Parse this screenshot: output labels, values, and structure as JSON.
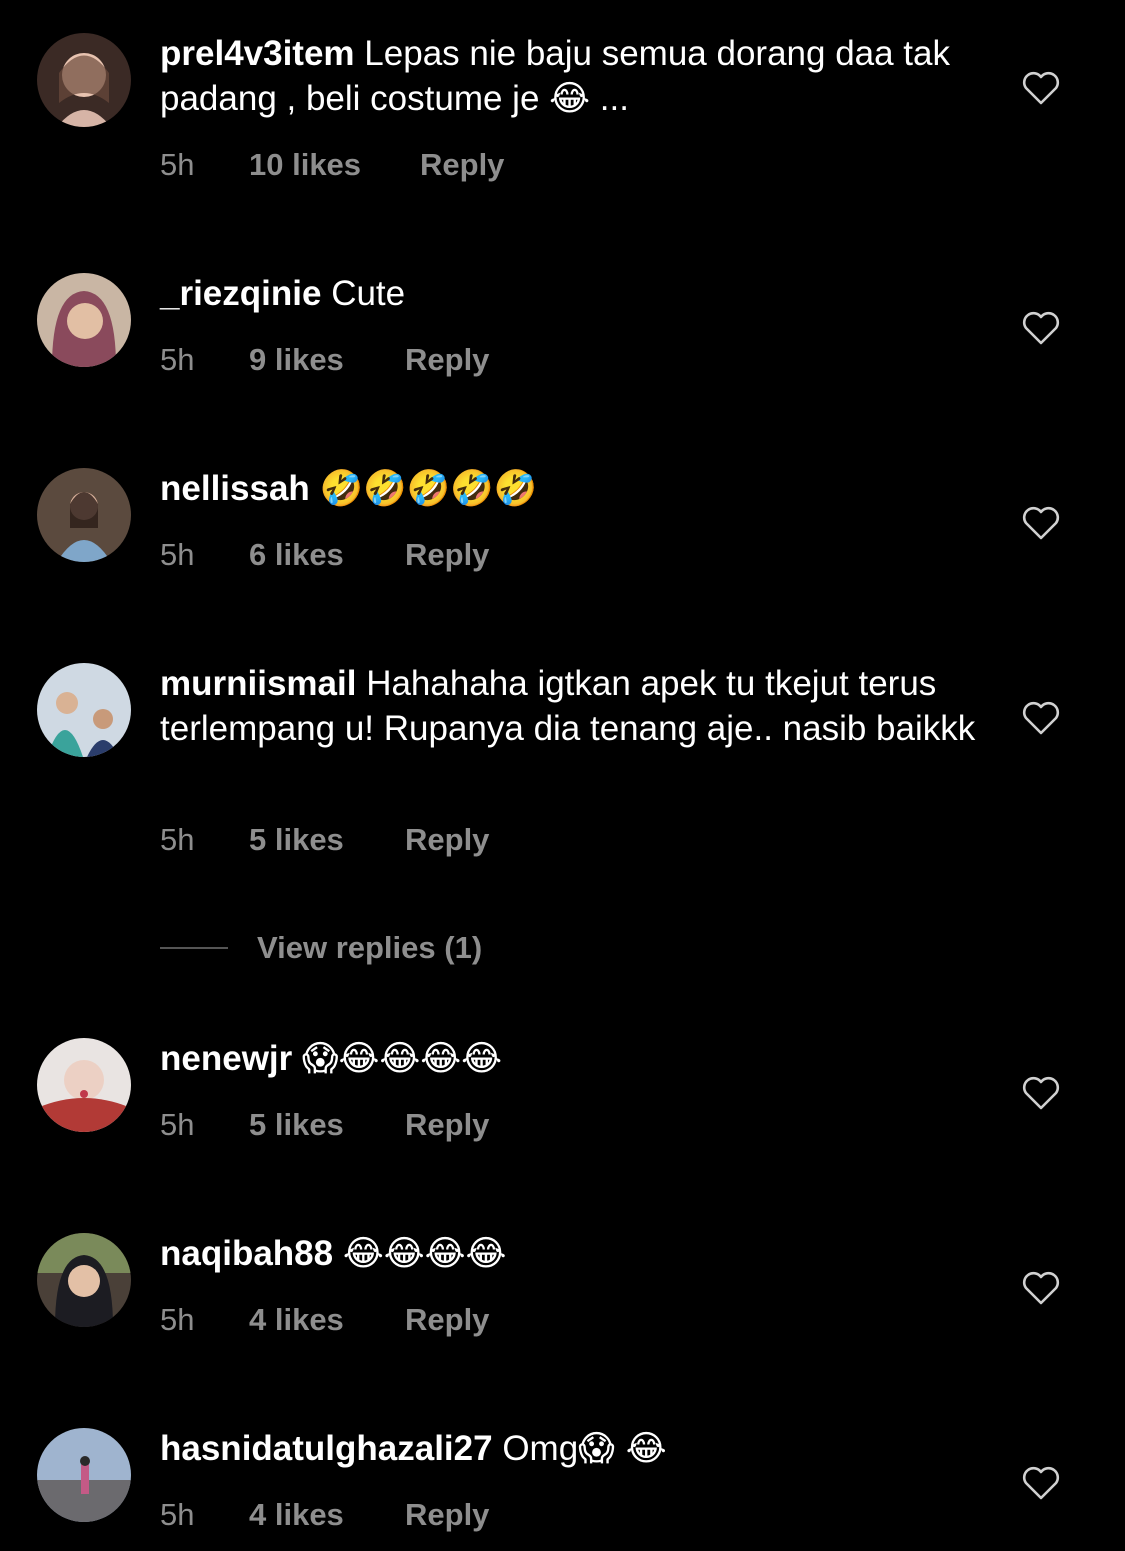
{
  "comments": [
    {
      "user": "prel4v3item",
      "text": "Lepas nie baju semua dorang daa tak padang , beli costume je",
      "emoji": "😂",
      "trail": " ...",
      "time": "5h",
      "likes": "10 likes",
      "reply": "Reply",
      "avatar_color": "#caa08f"
    },
    {
      "user": "_riezqinie",
      "text": "Cute",
      "emoji": "",
      "trail": "",
      "time": "5h",
      "likes": "9 likes",
      "reply": "Reply",
      "avatar_color": "#8a4a5c"
    },
    {
      "user": "nellissah",
      "text": "",
      "emoji": "🤣🤣🤣🤣🤣",
      "trail": "",
      "time": "5h",
      "likes": "6 likes",
      "reply": "Reply",
      "avatar_color": "#7fa6c9"
    },
    {
      "user": "murniismail",
      "text": "Hahahaha igtkan apek tu tkejut terus terlempang u! Rupanya dia tenang aje.. nasib baikkk",
      "emoji": "",
      "trail": "",
      "time": "5h",
      "likes": "5 likes",
      "reply": "Reply",
      "avatar_color": "#3aa39b"
    },
    {
      "user": "nenewjr",
      "text": "",
      "emoji": "😱😂😂😂😂",
      "trail": "",
      "time": "5h",
      "likes": "5 likes",
      "reply": "Reply",
      "avatar_color": "#b23a36"
    },
    {
      "user": "naqibah88",
      "text": "",
      "emoji": "😂😂😂😂",
      "trail": "",
      "time": "5h",
      "likes": "4 likes",
      "reply": "Reply",
      "avatar_color": "#4a4038"
    },
    {
      "user": "hasnidatulghazali27",
      "text": "Omg",
      "emoji": "😱 😂",
      "trail": "",
      "time": "5h",
      "likes": "4 likes",
      "reply": "Reply",
      "avatar_color": "#9fb4cf"
    }
  ],
  "view_replies": "View replies (1)"
}
